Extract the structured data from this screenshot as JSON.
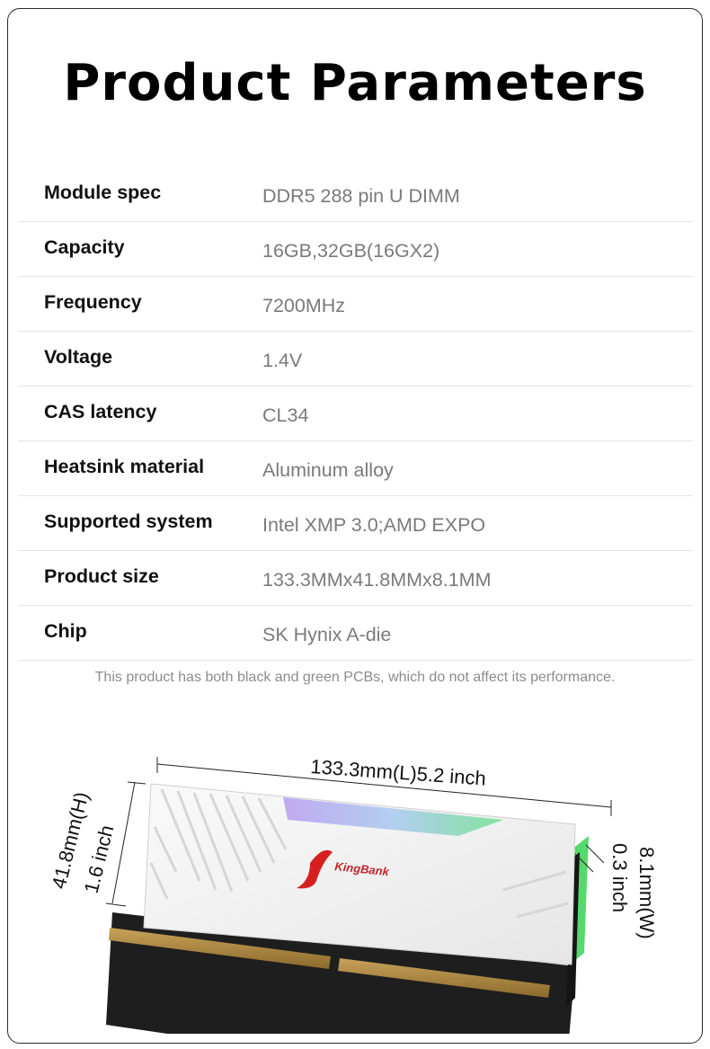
{
  "title": "Product Parameters",
  "specs": [
    {
      "label": "Module spec",
      "value": "DDR5 288 pin U DIMM"
    },
    {
      "label": "Capacity",
      "value": "16GB,32GB(16GX2)"
    },
    {
      "label": "Frequency",
      "value": "7200MHz"
    },
    {
      "label": "Voltage",
      "value": "1.4V"
    },
    {
      "label": "CAS latency",
      "value": "CL34"
    },
    {
      "label": "Heatsink material",
      "value": "Aluminum alloy"
    },
    {
      "label": "Supported system",
      "value": "Intel XMP 3.0;AMD EXPO"
    },
    {
      "label": "Product size",
      "value": "133.3MMx41.8MMx8.1MM"
    },
    {
      "label": "Chip",
      "value": "SK Hynix A-die"
    }
  ],
  "note": "This product has both black and green PCBs, which do not affect its performance.",
  "dimensions": {
    "length": "133.3mm(L)5.2 inch",
    "height_mm": "41.8mm(H)",
    "height_in": "1.6 inch",
    "width_mm": "8.1mm(W)",
    "width_in": "0.3 inch"
  },
  "brand": "KingBank"
}
